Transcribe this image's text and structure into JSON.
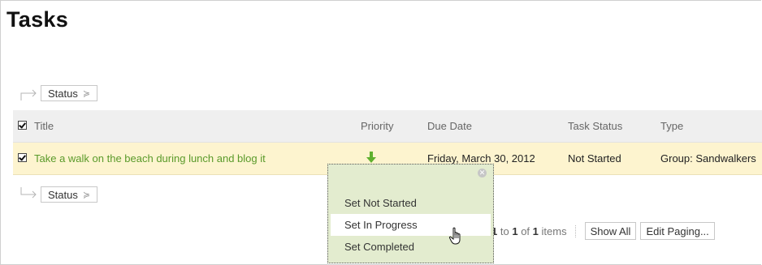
{
  "page": {
    "title": "Tasks"
  },
  "action_bar": {
    "status_label": "Status"
  },
  "table": {
    "columns": {
      "title": "Title",
      "priority": "Priority",
      "due": "Due Date",
      "status": "Task Status",
      "type": "Type"
    },
    "rows": [
      {
        "title": "Take a walk on the beach during lunch and blog it",
        "priority_icon": "down-arrow-icon",
        "due": "Friday, March 30, 2012",
        "status": "Not Started",
        "type": "Group: Sandwalkers"
      }
    ]
  },
  "status_menu": {
    "items": [
      "Set Not Started",
      "Set In Progress",
      "Set Completed"
    ],
    "hovered_index": 1
  },
  "pager": {
    "from": "1",
    "to": "1",
    "total": "1",
    "to_label": "to",
    "of_label": "of",
    "items_label": "items",
    "show_all_label": "Show All",
    "edit_paging_label": "Edit Paging..."
  },
  "colors": {
    "row_highlight": "#fdf4cf",
    "title_link": "#5a9a2a",
    "menu_bg": "#e3eccf",
    "priority_arrow": "#5fb02e"
  }
}
